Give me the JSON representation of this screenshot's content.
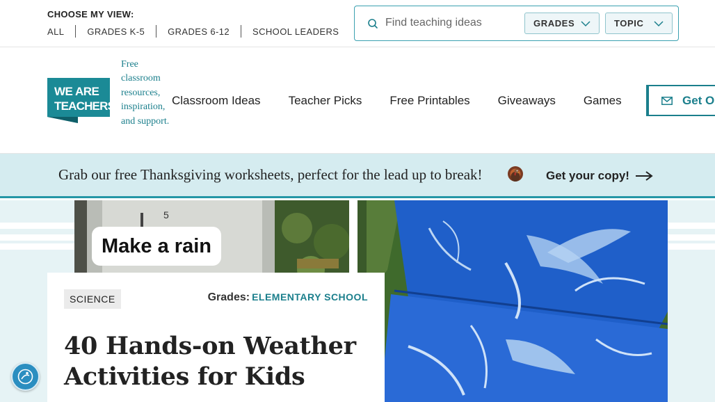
{
  "utility": {
    "view_title": "CHOOSE MY VIEW:",
    "views": [
      "ALL",
      "GRADES K-5",
      "GRADES 6-12",
      "SCHOOL LEADERS"
    ]
  },
  "search": {
    "placeholder": "Find teaching ideas",
    "value": "",
    "filters": {
      "grades": "GRADES",
      "topic": "TOPIC"
    }
  },
  "brand": {
    "logo_line1": "WE ARE",
    "logo_line2": "TEACHERS",
    "tagline": "Free classroom resources, inspiration, and support.",
    "color": "#1b7f8c"
  },
  "nav": {
    "items": [
      "Classroom Ideas",
      "Teacher Picks",
      "Free Printables",
      "Giveaways",
      "Games"
    ],
    "cta": "Get Ou"
  },
  "promo": {
    "text": "Grab our free Thanksgiving worksheets, perfect for the lead up to break!",
    "cta": "Get your copy!",
    "icon": "turkey-icon",
    "background": "#d5ecf0"
  },
  "article": {
    "category": "SCIENCE",
    "grades_label": "Grades:",
    "grades_value": "ELEMENTARY SCHOOL",
    "title": "40 Hands-on Weather Activities for Kids",
    "image_left_caption": "Make a rain"
  },
  "icons": {
    "search": "search-icon",
    "chevron": "chevron-down-icon",
    "mail": "mail-icon",
    "arrow": "arrow-right-icon",
    "accessibility": "accessibility-icon"
  }
}
